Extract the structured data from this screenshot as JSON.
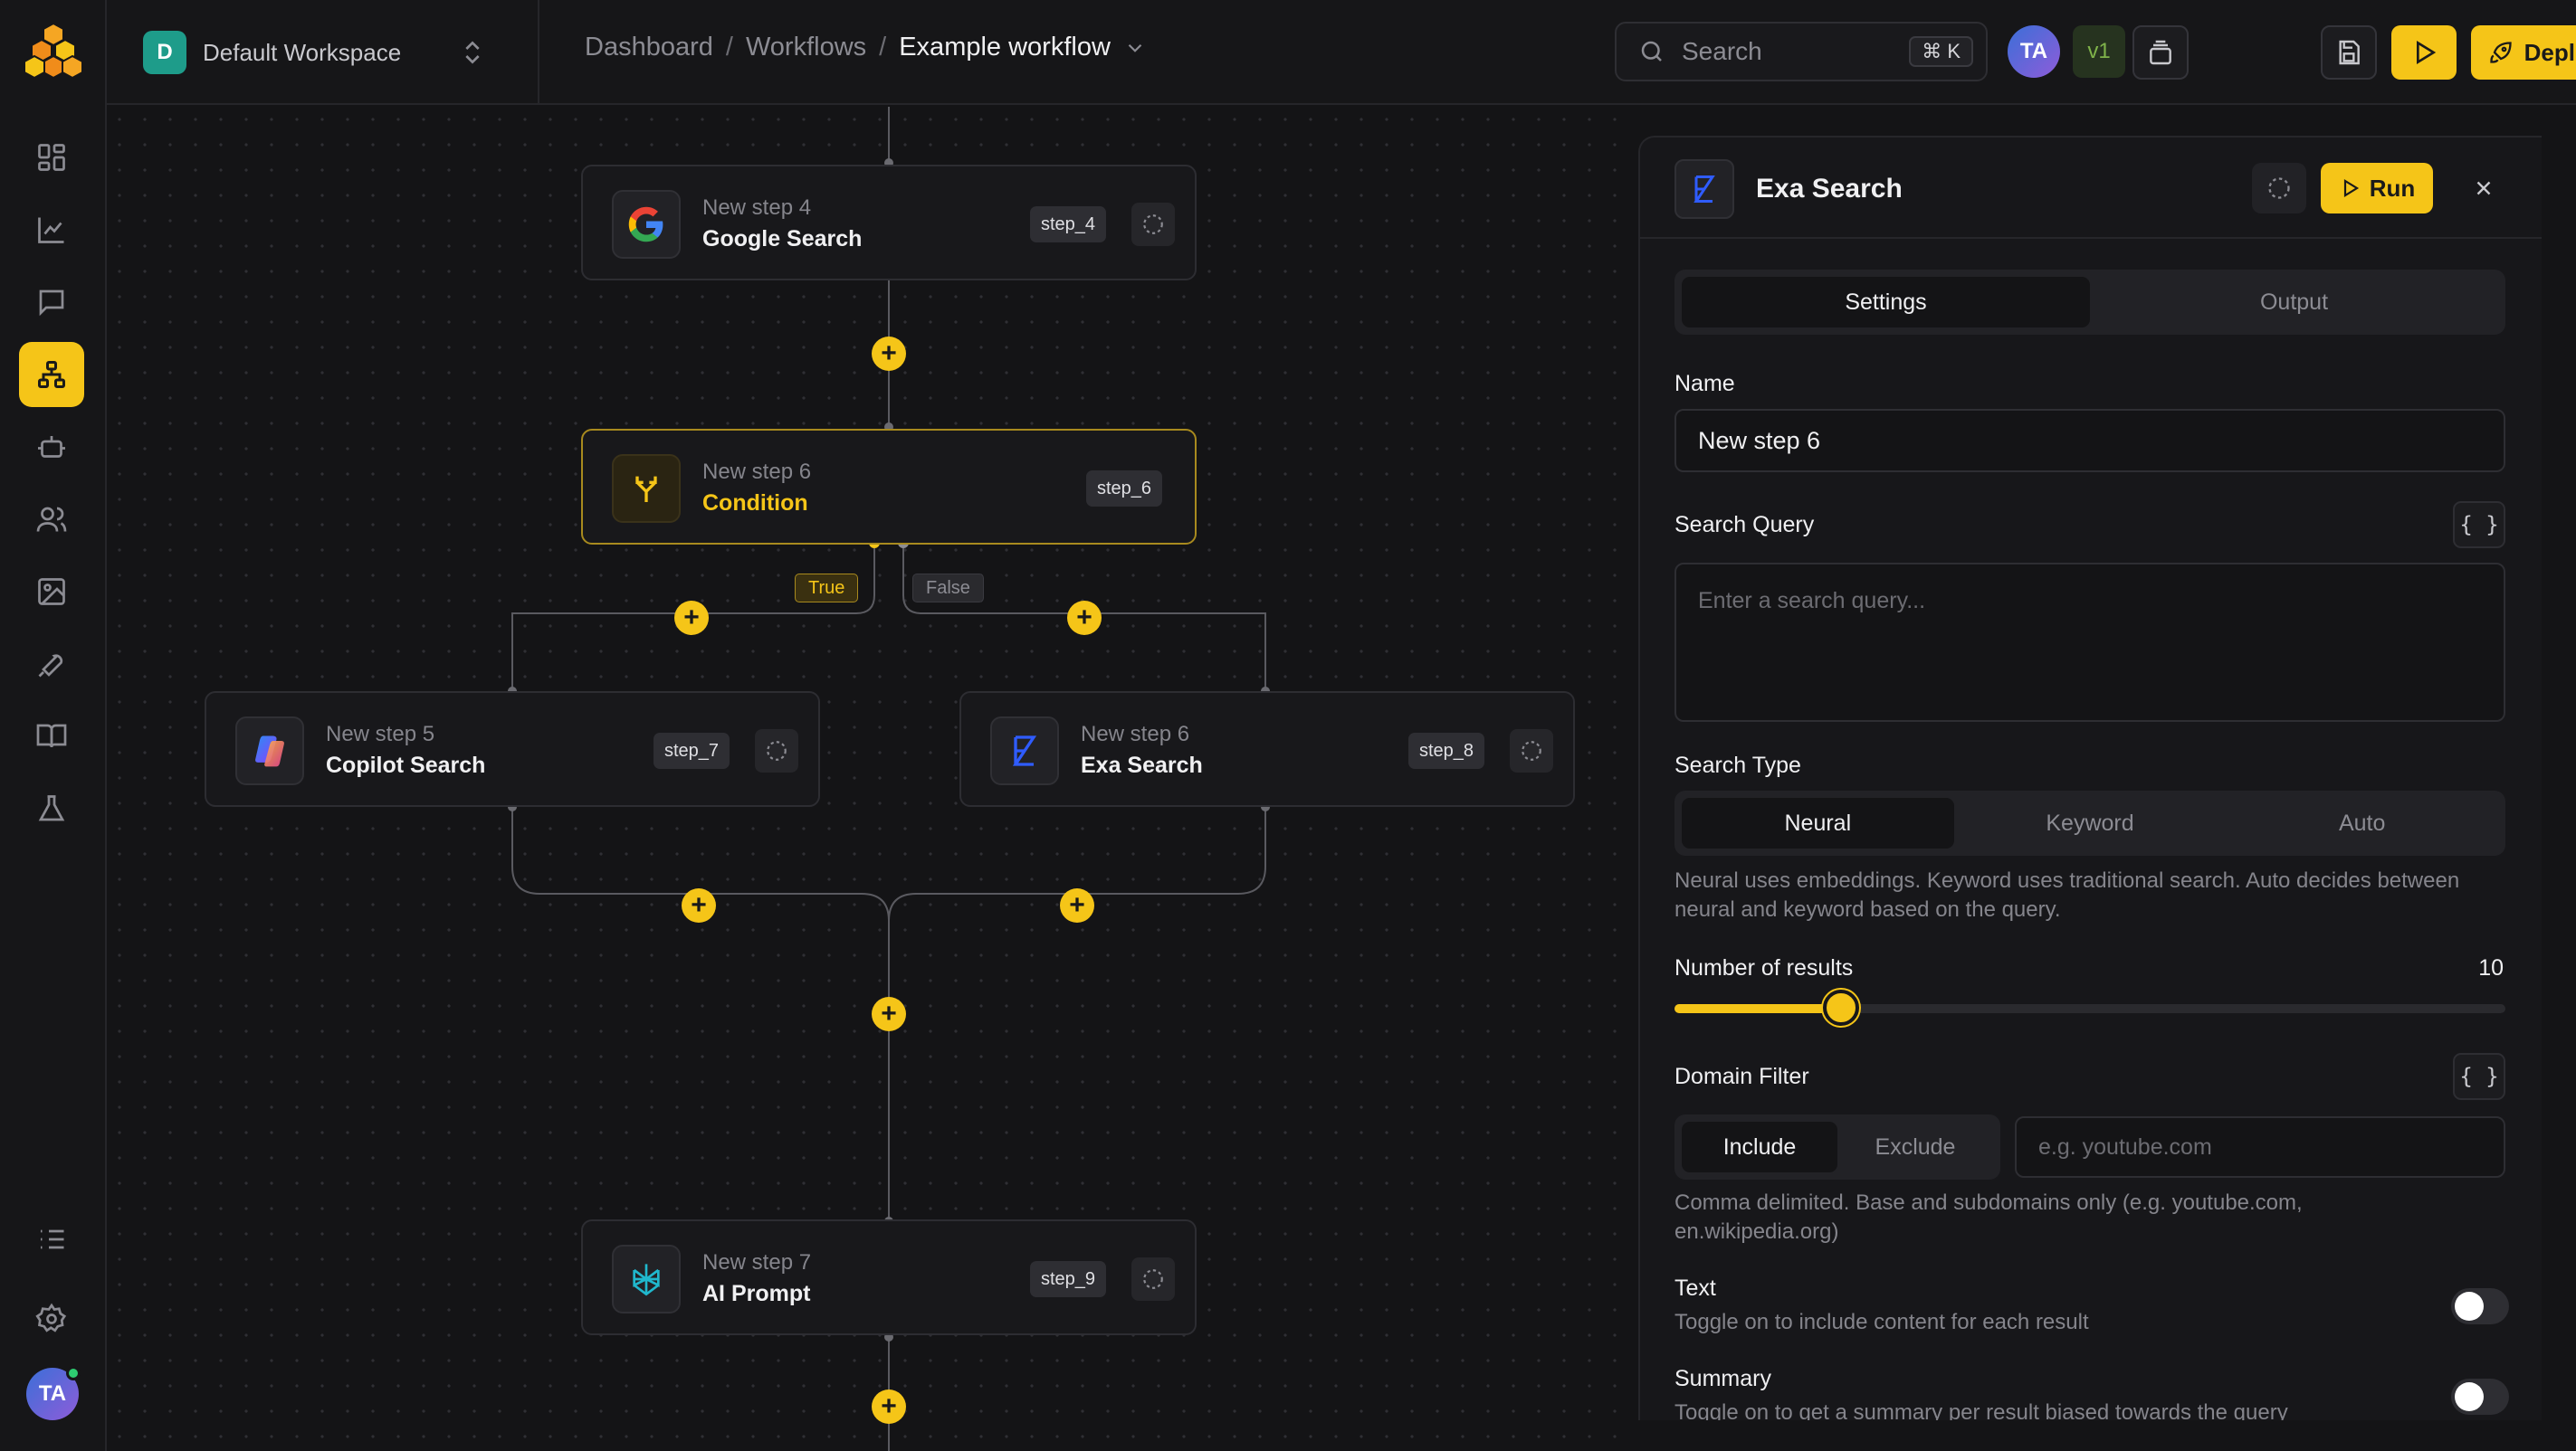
{
  "workspace": {
    "badge": "D",
    "name": "Default Workspace"
  },
  "breadcrumb": {
    "items": [
      "Dashboard",
      "Workflows"
    ],
    "current": "Example workflow",
    "separator": "/"
  },
  "search": {
    "placeholder": "Search",
    "shortcut": "⌘ K"
  },
  "user": {
    "initials": "TA"
  },
  "version": "v1",
  "deploy_label": "Deploy",
  "sidebar": {
    "items": [
      "dashboard-icon",
      "analytics-icon",
      "chat-icon",
      "workflows-icon",
      "agents-icon",
      "users-icon",
      "images-icon",
      "tools-icon",
      "docs-icon",
      "lab-icon",
      "list-icon",
      "settings-icon"
    ],
    "active": "workflows-icon"
  },
  "nodes": [
    {
      "id": "step_4",
      "subtitle": "New step 4",
      "title": "Google Search",
      "tag": "step_4",
      "icon": "google-icon"
    },
    {
      "id": "step_6",
      "subtitle": "New step 6",
      "title": "Condition",
      "tag": "step_6",
      "icon": "branch-icon"
    },
    {
      "id": "step_7",
      "subtitle": "New step 5",
      "title": "Copilot Search",
      "tag": "step_7",
      "icon": "copilot-icon"
    },
    {
      "id": "step_8",
      "subtitle": "New step 6",
      "title": "Exa Search",
      "tag": "step_8",
      "icon": "exa-icon"
    },
    {
      "id": "step_9",
      "subtitle": "New step 7",
      "title": "AI Prompt",
      "tag": "step_9",
      "icon": "perplexity-icon"
    }
  ],
  "branches": {
    "true_label": "True",
    "false_label": "False"
  },
  "panel": {
    "title": "Exa Search",
    "run_label": "Run",
    "tabs": [
      "Settings",
      "Output"
    ],
    "active_tab": "Settings",
    "name_label": "Name",
    "name_value": "New step 6",
    "query_label": "Search Query",
    "query_placeholder": "Enter a search query...",
    "brace_label": "{ }",
    "type_label": "Search Type",
    "type_options": [
      "Neural",
      "Keyword",
      "Auto"
    ],
    "type_selected": "Neural",
    "type_help": "Neural uses embeddings. Keyword uses traditional search. Auto decides between neural and keyword based on the query.",
    "results_label": "Number of results",
    "results_value": "10",
    "results_fraction": 0.2,
    "domain_label": "Domain Filter",
    "domain_modes": [
      "Include",
      "Exclude"
    ],
    "domain_selected": "Include",
    "domain_placeholder": "e.g. youtube.com",
    "domain_help": "Comma delimited. Base and subdomains only (e.g. youtube.com, en.wikipedia.org)",
    "text_label": "Text",
    "text_help": "Toggle on to include content for each result",
    "summary_label": "Summary",
    "summary_help": "Toggle on to get a summary per result biased towards the query"
  },
  "colors": {
    "accent": "#f5c518",
    "background": "#141416"
  }
}
